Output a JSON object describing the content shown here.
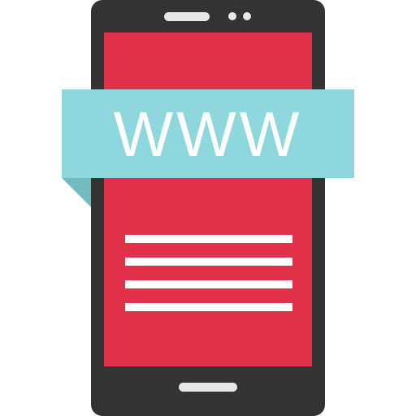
{
  "banner": {
    "text": "WWW"
  },
  "colors": {
    "phone_body": "#333333",
    "screen": "#e0304a",
    "banner": "#8dd7dd",
    "banner_fold": "#72bcc0",
    "text_lines": "#ffffff",
    "speaker_and_buttons": "#e8e8e8"
  },
  "icons": [
    "smartphone-icon",
    "www-banner-icon",
    "text-lines-icon"
  ]
}
